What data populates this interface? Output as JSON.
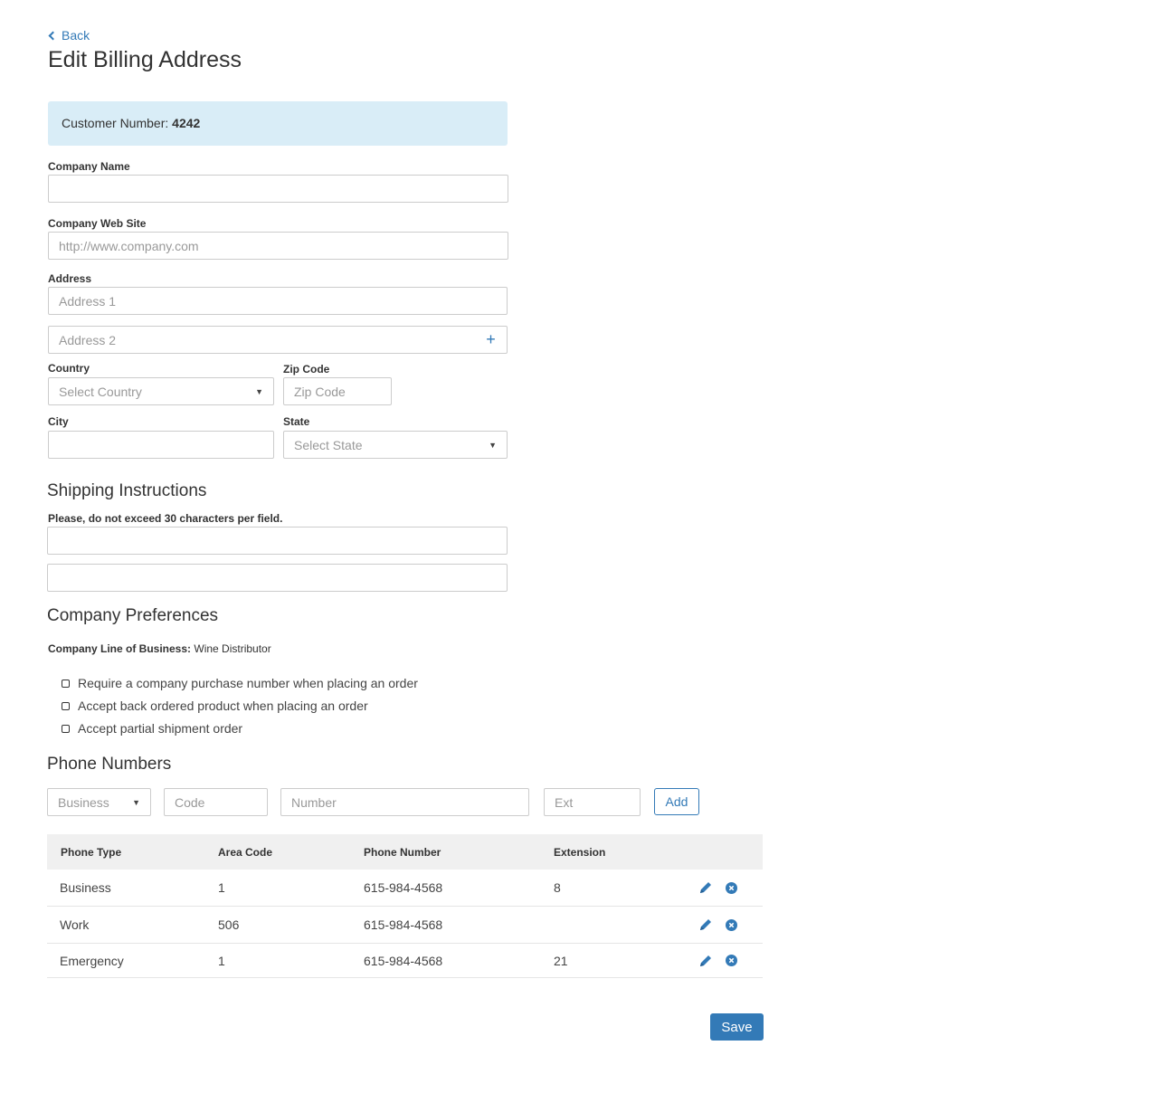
{
  "nav": {
    "back_label": "Back"
  },
  "page_title": "Edit Billing Address",
  "customer": {
    "label": "Customer Number:",
    "number": "4242"
  },
  "company_name": {
    "label": "Company Name",
    "value": "",
    "placeholder": ""
  },
  "company_website": {
    "label": "Company Web Site",
    "placeholder": "http://www.company.com"
  },
  "address": {
    "label": "Address",
    "line1_placeholder": "Address 1",
    "line2_placeholder": "Address 2",
    "add_icon": "plus-icon"
  },
  "country": {
    "label": "Country",
    "selected": "Select Country"
  },
  "zip": {
    "label": "Zip Code",
    "placeholder": "Zip Code"
  },
  "city": {
    "label": "City",
    "value": ""
  },
  "state": {
    "label": "State",
    "selected": "Select State"
  },
  "shipping": {
    "title": "Shipping Instructions",
    "note": "Please, do not exceed 30 characters per field."
  },
  "preferences": {
    "title": "Company Preferences",
    "line_of_business_label": "Company Line of Business:",
    "line_of_business_value": "Wine Distributor",
    "options": [
      {
        "label": "Require a company purchase number when placing an order",
        "checked": false
      },
      {
        "label": "Accept back ordered product when placing an order",
        "checked": false
      },
      {
        "label": "Accept partial shipment order",
        "checked": false
      }
    ]
  },
  "phones": {
    "title": "Phone Numbers",
    "type_selected": "Business",
    "code_placeholder": "Code",
    "number_placeholder": "Number",
    "ext_placeholder": "Ext",
    "add_label": "Add",
    "columns": [
      "Phone Type",
      "Area Code",
      "Phone Number",
      "Extension"
    ],
    "rows": [
      {
        "type": "Business",
        "area": "1",
        "number": "615-984-4568",
        "ext": "8"
      },
      {
        "type": "Work",
        "area": "506",
        "number": "615-984-4568",
        "ext": ""
      },
      {
        "type": "Emergency",
        "area": "1",
        "number": "615-984-4568",
        "ext": "21"
      }
    ]
  },
  "save_label": "Save",
  "colors": {
    "accent": "#337ab7",
    "info_bg": "#d9edf7",
    "table_header_bg": "#f0f0f0"
  }
}
